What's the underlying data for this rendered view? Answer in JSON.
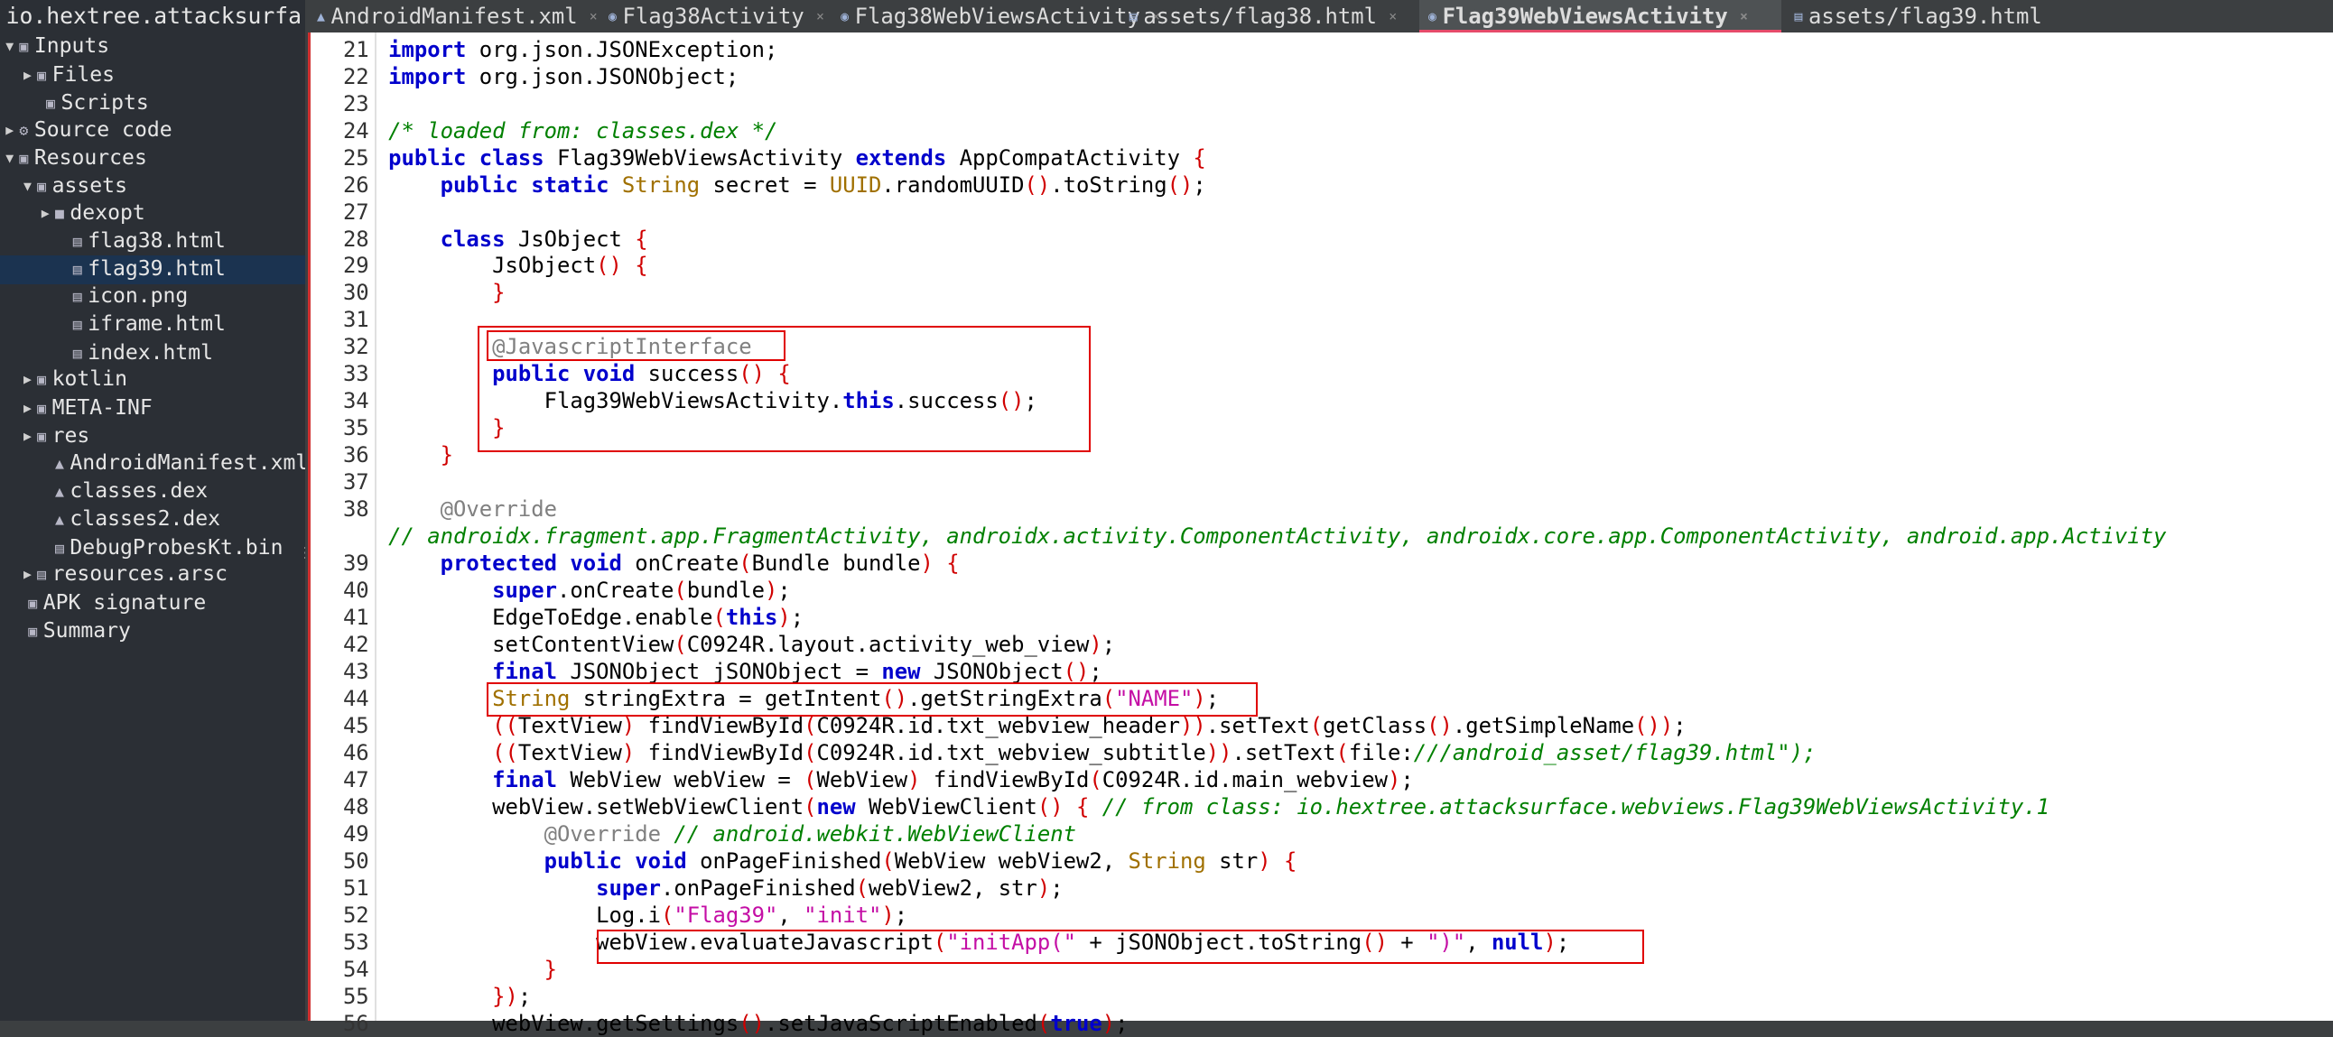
{
  "sidebar": {
    "title": "io.hextree.attacksurfa",
    "items": [
      {
        "label": "Inputs",
        "arrow": "▼",
        "icon": "▣"
      },
      {
        "label": "Files",
        "arrow": "▶",
        "icon": "▣"
      },
      {
        "label": "Scripts",
        "arrow": "",
        "icon": "▣"
      },
      {
        "label": "Source code",
        "arrow": "▶",
        "icon": "⚙"
      },
      {
        "label": "Resources",
        "arrow": "▼",
        "icon": "▣"
      },
      {
        "label": "assets",
        "arrow": "▼",
        "icon": "▣"
      },
      {
        "label": "dexopt",
        "arrow": "▶",
        "icon": "■"
      },
      {
        "label": "flag38.html",
        "arrow": "",
        "icon": "▤"
      },
      {
        "label": "flag39.html",
        "arrow": "",
        "icon": "▤"
      },
      {
        "label": "icon.png",
        "arrow": "",
        "icon": "▤"
      },
      {
        "label": "iframe.html",
        "arrow": "",
        "icon": "▤"
      },
      {
        "label": "index.html",
        "arrow": "",
        "icon": "▤"
      },
      {
        "label": "kotlin",
        "arrow": "▶",
        "icon": "▣"
      },
      {
        "label": "META-INF",
        "arrow": "▶",
        "icon": "▣"
      },
      {
        "label": "res",
        "arrow": "▶",
        "icon": "▣"
      },
      {
        "label": "AndroidManifest.xml",
        "arrow": "",
        "icon": "▲"
      },
      {
        "label": "classes.dex",
        "arrow": "",
        "icon": "▲"
      },
      {
        "label": "classes2.dex",
        "arrow": "",
        "icon": "▲"
      },
      {
        "label": "DebugProbesKt.bin",
        "arrow": "",
        "icon": "▤"
      },
      {
        "label": "resources.arsc",
        "arrow": "▶",
        "icon": "▤"
      },
      {
        "label": "APK signature",
        "arrow": "",
        "icon": "▣"
      },
      {
        "label": "Summary",
        "arrow": "",
        "icon": "▣"
      }
    ]
  },
  "tabs": [
    {
      "label": "AndroidManifest.xml",
      "icon": "▲"
    },
    {
      "label": "Flag38Activity",
      "icon": "◉"
    },
    {
      "label": "Flag38WebViewsActivity",
      "icon": "◉"
    },
    {
      "label": "assets/flag38.html",
      "icon": "▤"
    },
    {
      "label": "Flag39WebViewsActivity",
      "icon": "◉"
    },
    {
      "label": "assets/flag39.html",
      "icon": "▤"
    }
  ],
  "tab_close_glyph": "×",
  "editor": {
    "line_numbers": [
      "21",
      "22",
      "23",
      "24",
      "25",
      "26",
      "27",
      "28",
      "29",
      "30",
      "31",
      "32",
      "33",
      "34",
      "35",
      "36",
      "37",
      "38",
      "",
      "39",
      "40",
      "41",
      "42",
      "43",
      "44",
      "45",
      "46",
      "47",
      "48",
      "49",
      "50",
      "51",
      "52",
      "53",
      "54",
      "55",
      "56"
    ],
    "lines": [
      "import org.json.JSONException;",
      "import org.json.JSONObject;",
      "",
      "/* loaded from: classes.dex */",
      "public class Flag39WebViewsActivity extends AppCompatActivity {",
      "    public static String secret = UUID.randomUUID().toString();",
      "",
      "    class JsObject {",
      "        JsObject() {",
      "        }",
      "",
      "        @JavascriptInterface",
      "        public void success() {",
      "            Flag39WebViewsActivity.this.success();",
      "        }",
      "    }",
      "",
      "    @Override",
      "// androidx.fragment.app.FragmentActivity, androidx.activity.ComponentActivity, androidx.core.app.ComponentActivity, android.app.Activity",
      "    protected void onCreate(Bundle bundle) {",
      "        super.onCreate(bundle);",
      "        EdgeToEdge.enable(this);",
      "        setContentView(C0924R.layout.activity_web_view);",
      "        final JSONObject jSONObject = new JSONObject();",
      "        String stringExtra = getIntent().getStringExtra(\"NAME\");",
      "        ((TextView) findViewById(C0924R.id.txt_webview_header)).setText(getClass().getSimpleName());",
      "        ((TextView) findViewById(C0924R.id.txt_webview_subtitle)).setText(\"file:///android_asset/flag39.html\");",
      "        final WebView webView = (WebView) findViewById(C0924R.id.main_webview);",
      "        webView.setWebViewClient(new WebViewClient() { // from class: io.hextree.attacksurface.webviews.Flag39WebViewsActivity.1",
      "            @Override // android.webkit.WebViewClient",
      "            public void onPageFinished(WebView webView2, String str) {",
      "                super.onPageFinished(webView2, str);",
      "                Log.i(\"Flag39\", \"init\");",
      "                webView.evaluateJavascript(\"initApp(\" + jSONObject.toString() + \")\", null);",
      "            }",
      "        });",
      "        webView.getSettings().setJavaScriptEnabled(true);"
    ]
  }
}
